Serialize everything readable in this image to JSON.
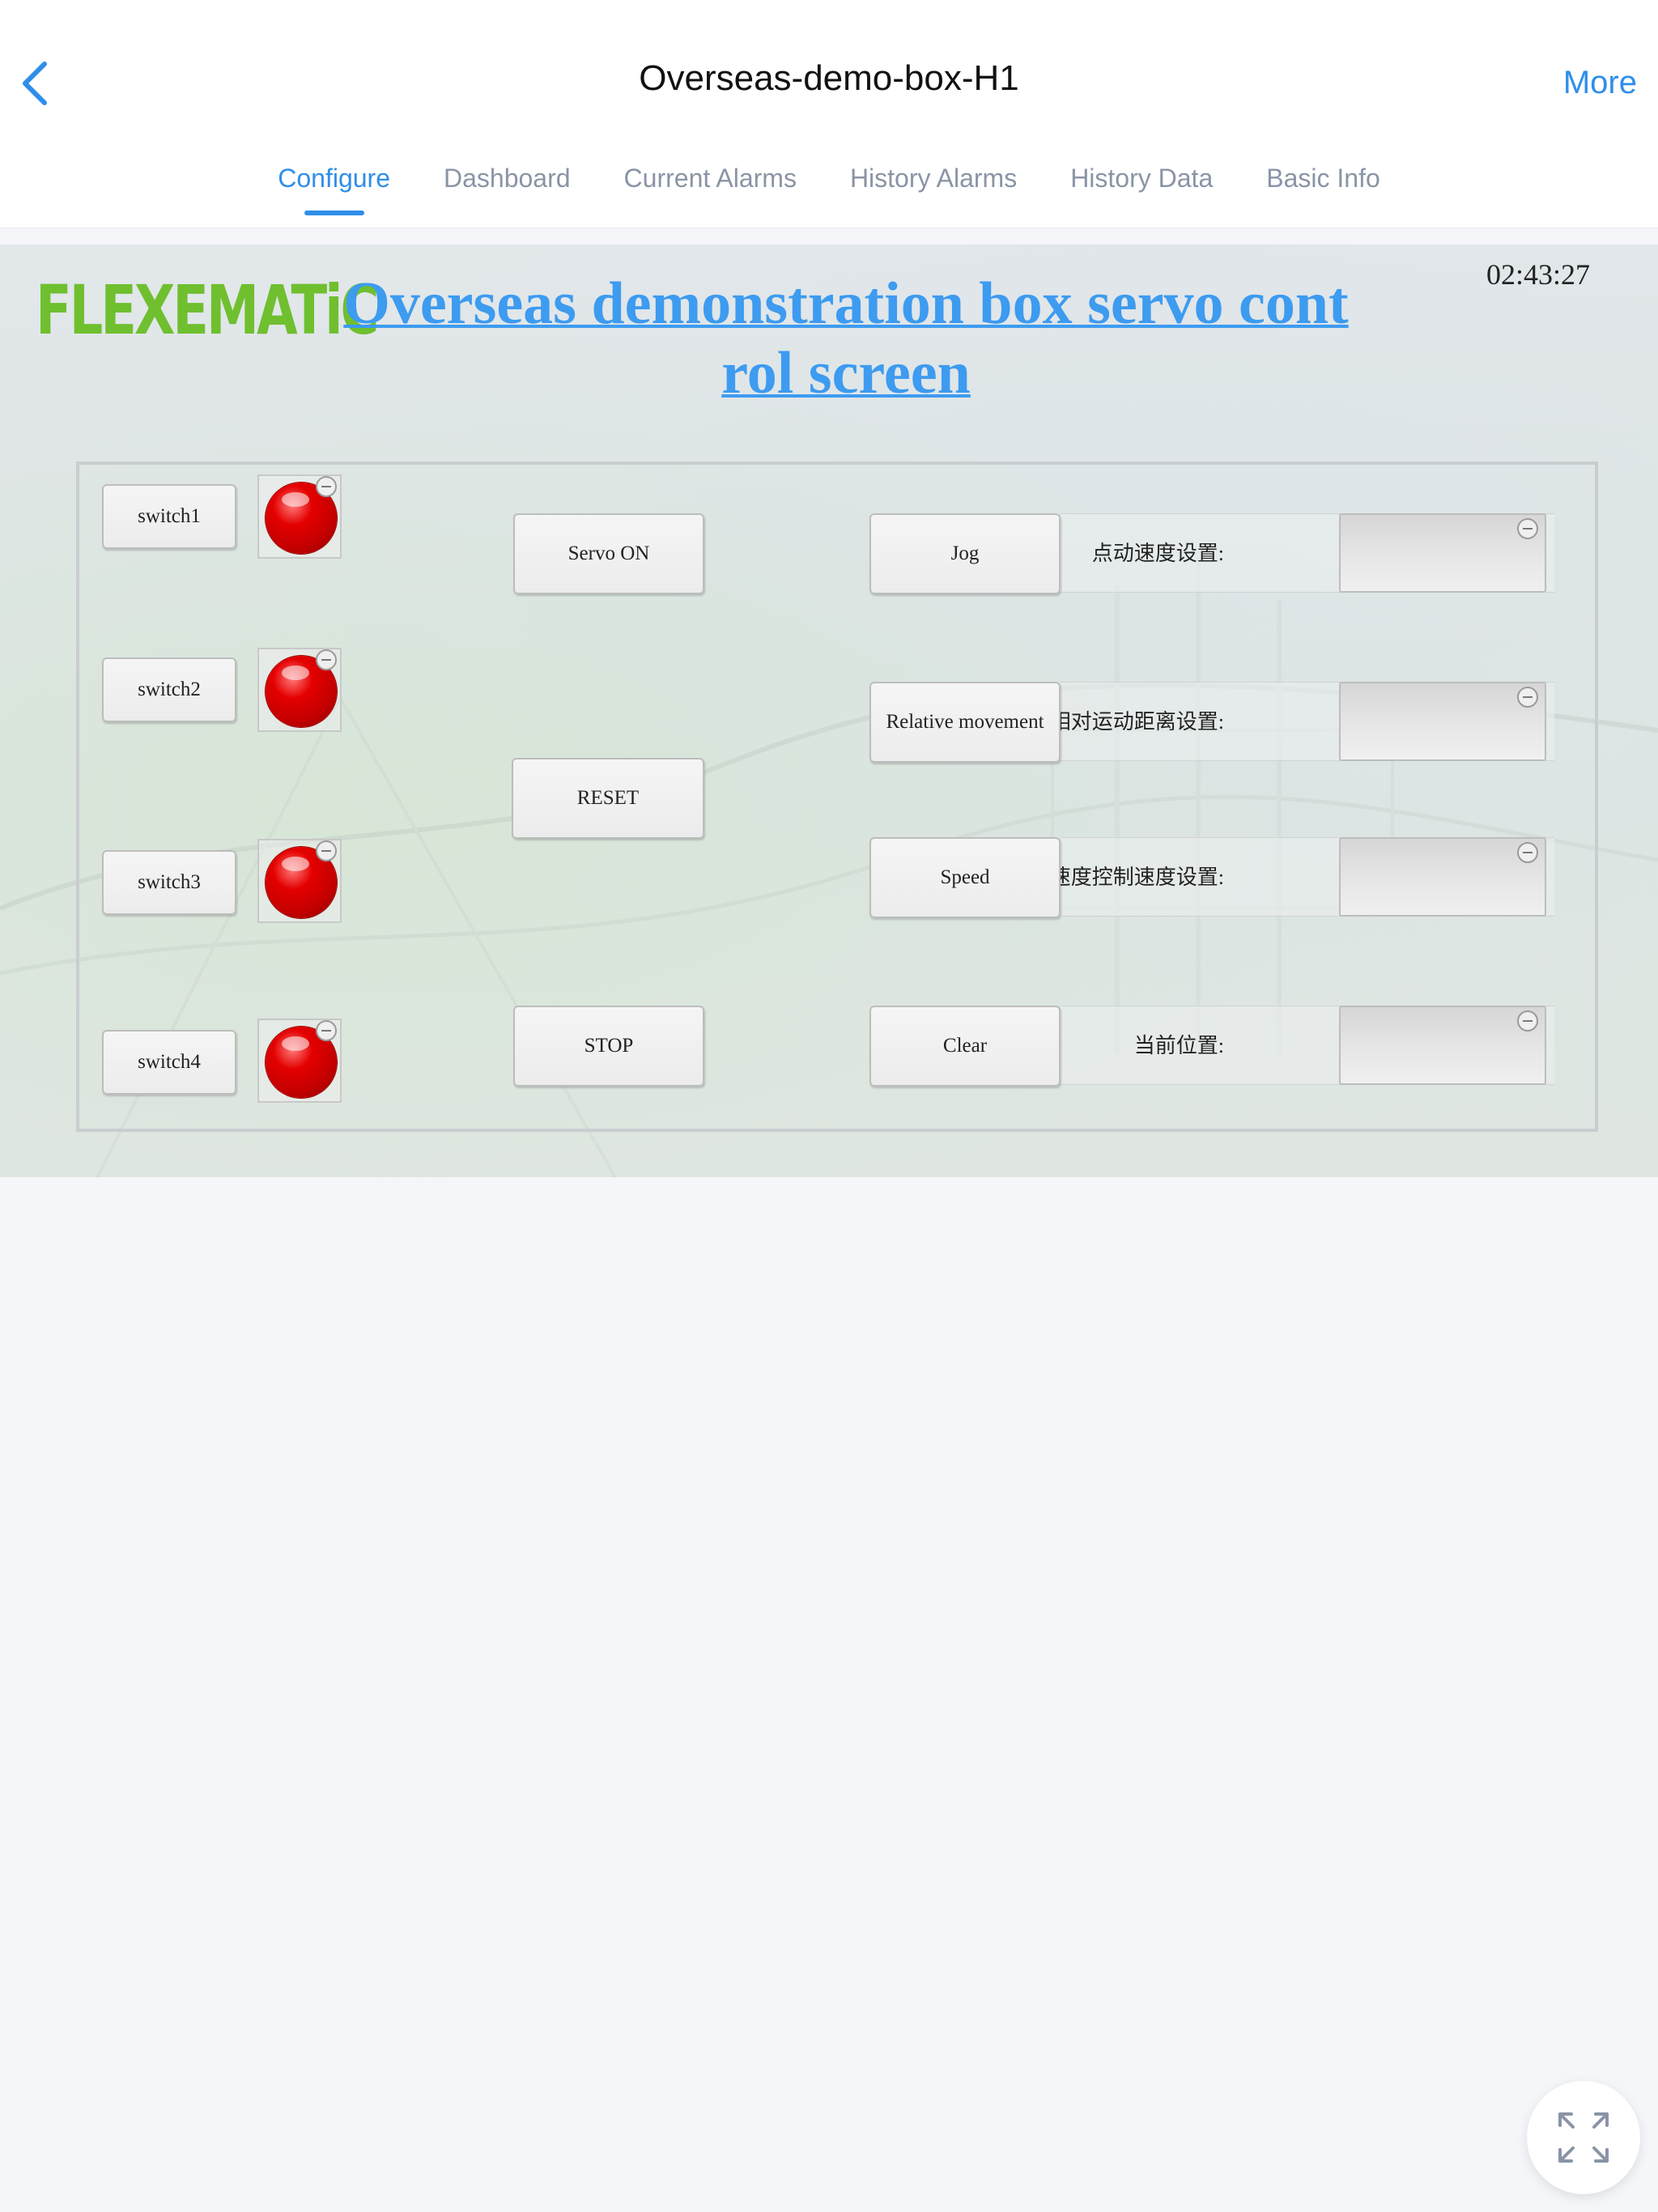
{
  "nav": {
    "title": "Overseas-demo-box-H1",
    "more_label": "More",
    "back_icon": "chevron-left-icon",
    "accent_color": "#2f8ee9"
  },
  "tabs": [
    {
      "label": "Configure",
      "active": true
    },
    {
      "label": "Dashboard",
      "active": false
    },
    {
      "label": "Current Alarms",
      "active": false
    },
    {
      "label": "History Alarms",
      "active": false
    },
    {
      "label": "History Data",
      "active": false
    },
    {
      "label": "Basic Info",
      "active": false
    }
  ],
  "hmi": {
    "logo": "FLEXEMATiC",
    "logo_color": "#6fbf2f",
    "title": "Overseas demonstration box servo control screen",
    "title_color": "#3d9bf0",
    "clock": "02:43:27",
    "switches": [
      {
        "label": "switch1",
        "lamp_state": "red"
      },
      {
        "label": "switch2",
        "lamp_state": "red"
      },
      {
        "label": "switch3",
        "lamp_state": "red"
      },
      {
        "label": "switch4",
        "lamp_state": "red"
      }
    ],
    "controls": {
      "servo_on": "Servo ON",
      "reset": "RESET",
      "stop": "STOP"
    },
    "motion_rows": [
      {
        "button": "Jog",
        "label": "点动速度设置:",
        "value": ""
      },
      {
        "button": "Relative movement",
        "label": "相对运动距离设置:",
        "value": ""
      },
      {
        "button": "Speed",
        "label": "速度控制速度设置:",
        "value": ""
      },
      {
        "button": "Clear",
        "label": "当前位置:",
        "value": ""
      }
    ]
  },
  "fab": {
    "icon": "fullscreen-expand-icon"
  }
}
